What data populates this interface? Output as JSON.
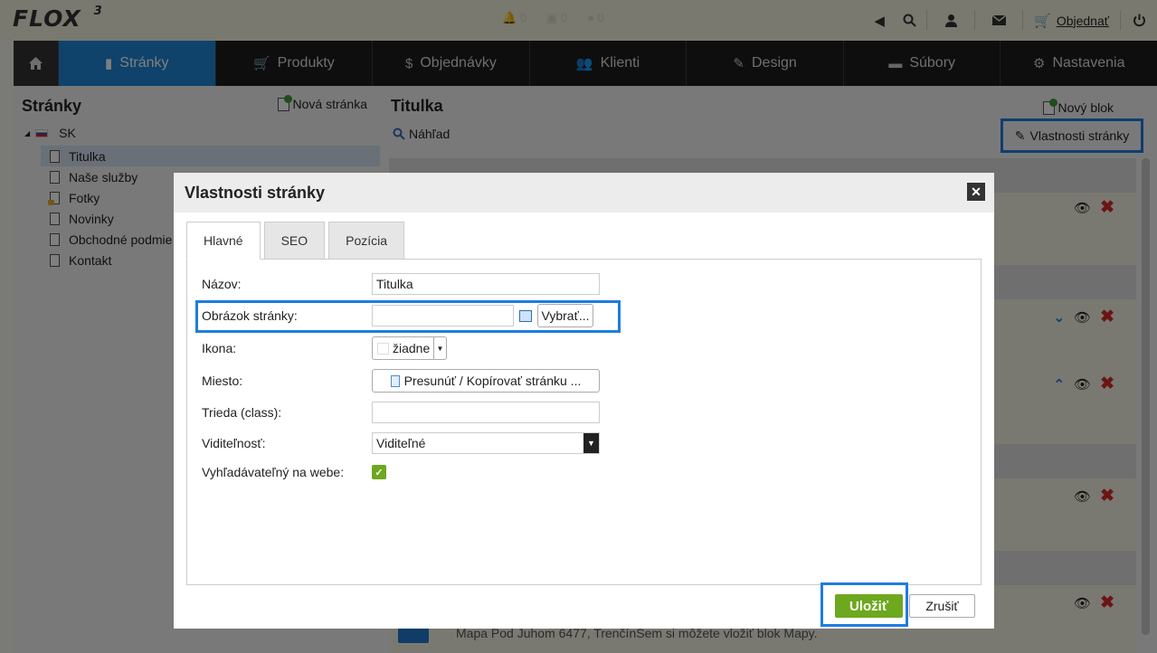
{
  "app": {
    "logo": "FLOX",
    "version": "3"
  },
  "topbar": {
    "order_link": "Objednať",
    "ghost_counts": [
      "0",
      "0",
      "0"
    ]
  },
  "nav": {
    "items": [
      {
        "label": "Stránky",
        "icon": "file-icon",
        "active": true
      },
      {
        "label": "Produkty",
        "icon": "cart-icon"
      },
      {
        "label": "Objednávky",
        "icon": "dollar-icon"
      },
      {
        "label": "Klienti",
        "icon": "users-icon"
      },
      {
        "label": "Design",
        "icon": "brush-icon"
      },
      {
        "label": "Súbory",
        "icon": "folder-icon"
      },
      {
        "label": "Nastavenia",
        "icon": "gear-icon"
      }
    ]
  },
  "sidebar": {
    "title": "Stránky",
    "new_page": "Nová stránka",
    "root": "SK",
    "pages": [
      "Titulka",
      "Naše služby",
      "Fotky",
      "Novinky",
      "Obchodné podmie",
      "Kontakt"
    ]
  },
  "content": {
    "title": "Titulka",
    "preview": "Náhľad",
    "new_block": "Nový blok",
    "page_props": "Vlastnosti stránky",
    "footer_text": "Mapa Pod Juhom 6477, TrenčínSem si môžete vložiť blok Mapy."
  },
  "modal": {
    "title": "Vlastnosti stránky",
    "tabs": [
      "Hlavné",
      "SEO",
      "Pozícia"
    ],
    "fields": {
      "name_label": "Názov:",
      "name_value": "Titulka",
      "image_label": "Obrázok stránky:",
      "image_value": "",
      "choose_button": "Vybrať...",
      "icon_label": "Ikona:",
      "icon_value": "žiadne",
      "place_label": "Miesto:",
      "place_button": "Presunúť / Kopírovať stránku ...",
      "class_label": "Trieda (class):",
      "class_value": "",
      "visibility_label": "Viditeľnosť:",
      "visibility_value": "Viditeľné",
      "searchable_label": "Vyhľadávateľný na webe:",
      "searchable_checked": true
    },
    "save": "Uložiť",
    "cancel": "Zrušiť"
  },
  "colors": {
    "accent": "#1f87d6",
    "save": "#6da81e",
    "highlight": "#1e7ce0",
    "delete": "#d62a2a"
  }
}
